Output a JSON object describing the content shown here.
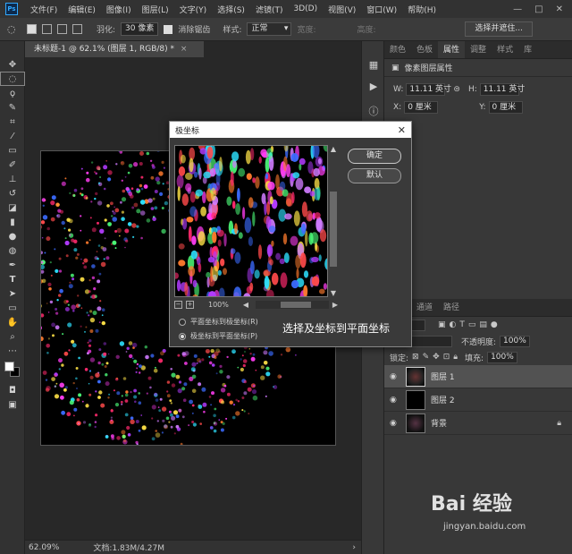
{
  "menubar": {
    "logo": "Ps",
    "items": [
      "文件(F)",
      "编辑(E)",
      "图像(I)",
      "图层(L)",
      "文字(Y)",
      "选择(S)",
      "滤镜(T)",
      "3D(D)",
      "视图(V)",
      "窗口(W)",
      "帮助(H)"
    ],
    "controls": [
      "—",
      "□",
      "✕"
    ]
  },
  "optionsbar": {
    "feather_label": "羽化:",
    "feather_value": "30 像素",
    "antialias_label": "消除锯齿",
    "style_label": "样式:",
    "style_value": "正常",
    "width_label": "宽度:",
    "height_label": "高度:",
    "select_mask_button": "选择并遮住..."
  },
  "document": {
    "tab_title": "未标题-1 @ 62.1% (图层 1, RGB/8) *",
    "close": "×",
    "zoom": "62.09%",
    "doc_info": "文档:1.83M/4.27M",
    "arrow": "›"
  },
  "properties": {
    "tabs": [
      "颜色",
      "色板",
      "属性",
      "调整",
      "样式",
      "库"
    ],
    "active_tab": 2,
    "header": "像素图层属性",
    "w_label": "W:",
    "w_value": "11.11 英寸",
    "h_label": "H:",
    "h_value": "11.11 英寸",
    "x_label": "X:",
    "x_value": "0 厘米",
    "y_label": "Y:",
    "y_value": "0 厘米"
  },
  "layers": {
    "tabs": [
      "图层",
      "通道",
      "路径"
    ],
    "kind_label": "类型",
    "opacity_label": "不透明度:",
    "opacity_value": "100%",
    "lock_label": "锁定:",
    "fill_label": "填充:",
    "fill_value": "100%",
    "items": [
      {
        "name": "图层 1"
      },
      {
        "name": "图层 2"
      },
      {
        "name": "背景"
      }
    ]
  },
  "dialog": {
    "title": "极坐标",
    "close": "✕",
    "ok_button": "确定",
    "default_button": "默认",
    "zoom_value": "100%",
    "option_rect_to_polar": "平面坐标到极坐标(R)",
    "option_polar_to_rect": "极坐标到平面坐标(P)",
    "selected_option": 1
  },
  "annotation": "选择及坐标到平面坐标",
  "watermark": {
    "text": "Bai 经验",
    "url": "jingyan.baidu.com"
  },
  "colors": {
    "foreground": "#ffffff",
    "background": "#000000",
    "accent": "#31a8ff"
  }
}
